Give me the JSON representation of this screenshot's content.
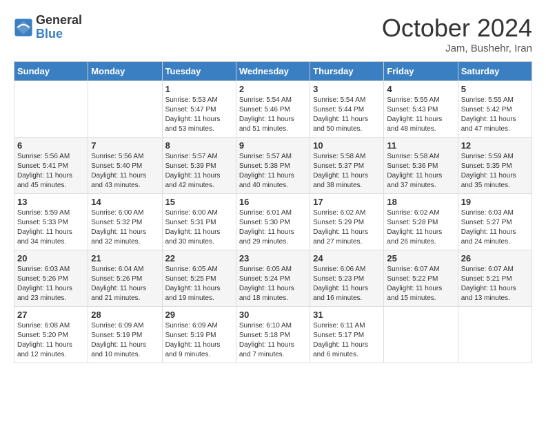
{
  "header": {
    "logo_general": "General",
    "logo_blue": "Blue",
    "month_title": "October 2024",
    "subtitle": "Jam, Bushehr, Iran"
  },
  "weekdays": [
    "Sunday",
    "Monday",
    "Tuesday",
    "Wednesday",
    "Thursday",
    "Friday",
    "Saturday"
  ],
  "rows": [
    [
      {
        "day": "",
        "detail": ""
      },
      {
        "day": "",
        "detail": ""
      },
      {
        "day": "1",
        "detail": "Sunrise: 5:53 AM\nSunset: 5:47 PM\nDaylight: 11 hours and 53 minutes."
      },
      {
        "day": "2",
        "detail": "Sunrise: 5:54 AM\nSunset: 5:46 PM\nDaylight: 11 hours and 51 minutes."
      },
      {
        "day": "3",
        "detail": "Sunrise: 5:54 AM\nSunset: 5:44 PM\nDaylight: 11 hours and 50 minutes."
      },
      {
        "day": "4",
        "detail": "Sunrise: 5:55 AM\nSunset: 5:43 PM\nDaylight: 11 hours and 48 minutes."
      },
      {
        "day": "5",
        "detail": "Sunrise: 5:55 AM\nSunset: 5:42 PM\nDaylight: 11 hours and 47 minutes."
      }
    ],
    [
      {
        "day": "6",
        "detail": "Sunrise: 5:56 AM\nSunset: 5:41 PM\nDaylight: 11 hours and 45 minutes."
      },
      {
        "day": "7",
        "detail": "Sunrise: 5:56 AM\nSunset: 5:40 PM\nDaylight: 11 hours and 43 minutes."
      },
      {
        "day": "8",
        "detail": "Sunrise: 5:57 AM\nSunset: 5:39 PM\nDaylight: 11 hours and 42 minutes."
      },
      {
        "day": "9",
        "detail": "Sunrise: 5:57 AM\nSunset: 5:38 PM\nDaylight: 11 hours and 40 minutes."
      },
      {
        "day": "10",
        "detail": "Sunrise: 5:58 AM\nSunset: 5:37 PM\nDaylight: 11 hours and 38 minutes."
      },
      {
        "day": "11",
        "detail": "Sunrise: 5:58 AM\nSunset: 5:36 PM\nDaylight: 11 hours and 37 minutes."
      },
      {
        "day": "12",
        "detail": "Sunrise: 5:59 AM\nSunset: 5:35 PM\nDaylight: 11 hours and 35 minutes."
      }
    ],
    [
      {
        "day": "13",
        "detail": "Sunrise: 5:59 AM\nSunset: 5:33 PM\nDaylight: 11 hours and 34 minutes."
      },
      {
        "day": "14",
        "detail": "Sunrise: 6:00 AM\nSunset: 5:32 PM\nDaylight: 11 hours and 32 minutes."
      },
      {
        "day": "15",
        "detail": "Sunrise: 6:00 AM\nSunset: 5:31 PM\nDaylight: 11 hours and 30 minutes."
      },
      {
        "day": "16",
        "detail": "Sunrise: 6:01 AM\nSunset: 5:30 PM\nDaylight: 11 hours and 29 minutes."
      },
      {
        "day": "17",
        "detail": "Sunrise: 6:02 AM\nSunset: 5:29 PM\nDaylight: 11 hours and 27 minutes."
      },
      {
        "day": "18",
        "detail": "Sunrise: 6:02 AM\nSunset: 5:28 PM\nDaylight: 11 hours and 26 minutes."
      },
      {
        "day": "19",
        "detail": "Sunrise: 6:03 AM\nSunset: 5:27 PM\nDaylight: 11 hours and 24 minutes."
      }
    ],
    [
      {
        "day": "20",
        "detail": "Sunrise: 6:03 AM\nSunset: 5:26 PM\nDaylight: 11 hours and 23 minutes."
      },
      {
        "day": "21",
        "detail": "Sunrise: 6:04 AM\nSunset: 5:26 PM\nDaylight: 11 hours and 21 minutes."
      },
      {
        "day": "22",
        "detail": "Sunrise: 6:05 AM\nSunset: 5:25 PM\nDaylight: 11 hours and 19 minutes."
      },
      {
        "day": "23",
        "detail": "Sunrise: 6:05 AM\nSunset: 5:24 PM\nDaylight: 11 hours and 18 minutes."
      },
      {
        "day": "24",
        "detail": "Sunrise: 6:06 AM\nSunset: 5:23 PM\nDaylight: 11 hours and 16 minutes."
      },
      {
        "day": "25",
        "detail": "Sunrise: 6:07 AM\nSunset: 5:22 PM\nDaylight: 11 hours and 15 minutes."
      },
      {
        "day": "26",
        "detail": "Sunrise: 6:07 AM\nSunset: 5:21 PM\nDaylight: 11 hours and 13 minutes."
      }
    ],
    [
      {
        "day": "27",
        "detail": "Sunrise: 6:08 AM\nSunset: 5:20 PM\nDaylight: 11 hours and 12 minutes."
      },
      {
        "day": "28",
        "detail": "Sunrise: 6:09 AM\nSunset: 5:19 PM\nDaylight: 11 hours and 10 minutes."
      },
      {
        "day": "29",
        "detail": "Sunrise: 6:09 AM\nSunset: 5:19 PM\nDaylight: 11 hours and 9 minutes."
      },
      {
        "day": "30",
        "detail": "Sunrise: 6:10 AM\nSunset: 5:18 PM\nDaylight: 11 hours and 7 minutes."
      },
      {
        "day": "31",
        "detail": "Sunrise: 6:11 AM\nSunset: 5:17 PM\nDaylight: 11 hours and 6 minutes."
      },
      {
        "day": "",
        "detail": ""
      },
      {
        "day": "",
        "detail": ""
      }
    ]
  ]
}
